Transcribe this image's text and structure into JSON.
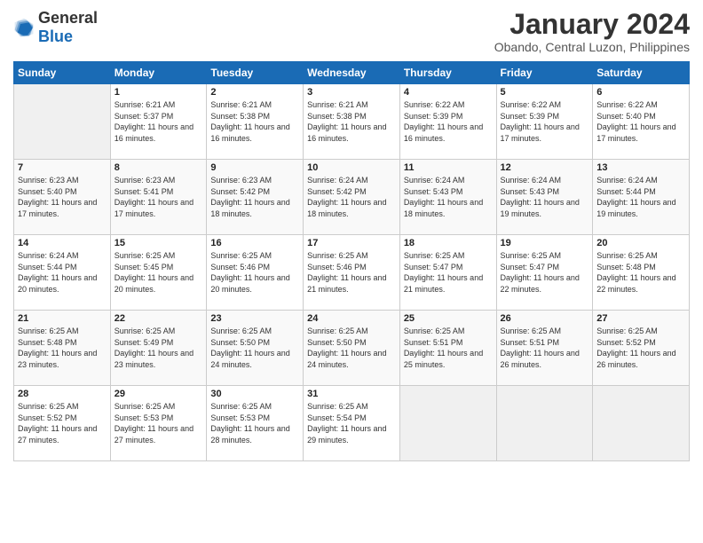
{
  "logo": {
    "text_general": "General",
    "text_blue": "Blue"
  },
  "title": "January 2024",
  "subtitle": "Obando, Central Luzon, Philippines",
  "days_of_week": [
    "Sunday",
    "Monday",
    "Tuesday",
    "Wednesday",
    "Thursday",
    "Friday",
    "Saturday"
  ],
  "weeks": [
    [
      {
        "num": "",
        "sunrise": "",
        "sunset": "",
        "daylight": "",
        "empty": true
      },
      {
        "num": "1",
        "sunrise": "Sunrise: 6:21 AM",
        "sunset": "Sunset: 5:37 PM",
        "daylight": "Daylight: 11 hours and 16 minutes."
      },
      {
        "num": "2",
        "sunrise": "Sunrise: 6:21 AM",
        "sunset": "Sunset: 5:38 PM",
        "daylight": "Daylight: 11 hours and 16 minutes."
      },
      {
        "num": "3",
        "sunrise": "Sunrise: 6:21 AM",
        "sunset": "Sunset: 5:38 PM",
        "daylight": "Daylight: 11 hours and 16 minutes."
      },
      {
        "num": "4",
        "sunrise": "Sunrise: 6:22 AM",
        "sunset": "Sunset: 5:39 PM",
        "daylight": "Daylight: 11 hours and 16 minutes."
      },
      {
        "num": "5",
        "sunrise": "Sunrise: 6:22 AM",
        "sunset": "Sunset: 5:39 PM",
        "daylight": "Daylight: 11 hours and 17 minutes."
      },
      {
        "num": "6",
        "sunrise": "Sunrise: 6:22 AM",
        "sunset": "Sunset: 5:40 PM",
        "daylight": "Daylight: 11 hours and 17 minutes."
      }
    ],
    [
      {
        "num": "7",
        "sunrise": "Sunrise: 6:23 AM",
        "sunset": "Sunset: 5:40 PM",
        "daylight": "Daylight: 11 hours and 17 minutes."
      },
      {
        "num": "8",
        "sunrise": "Sunrise: 6:23 AM",
        "sunset": "Sunset: 5:41 PM",
        "daylight": "Daylight: 11 hours and 17 minutes."
      },
      {
        "num": "9",
        "sunrise": "Sunrise: 6:23 AM",
        "sunset": "Sunset: 5:42 PM",
        "daylight": "Daylight: 11 hours and 18 minutes."
      },
      {
        "num": "10",
        "sunrise": "Sunrise: 6:24 AM",
        "sunset": "Sunset: 5:42 PM",
        "daylight": "Daylight: 11 hours and 18 minutes."
      },
      {
        "num": "11",
        "sunrise": "Sunrise: 6:24 AM",
        "sunset": "Sunset: 5:43 PM",
        "daylight": "Daylight: 11 hours and 18 minutes."
      },
      {
        "num": "12",
        "sunrise": "Sunrise: 6:24 AM",
        "sunset": "Sunset: 5:43 PM",
        "daylight": "Daylight: 11 hours and 19 minutes."
      },
      {
        "num": "13",
        "sunrise": "Sunrise: 6:24 AM",
        "sunset": "Sunset: 5:44 PM",
        "daylight": "Daylight: 11 hours and 19 minutes."
      }
    ],
    [
      {
        "num": "14",
        "sunrise": "Sunrise: 6:24 AM",
        "sunset": "Sunset: 5:44 PM",
        "daylight": "Daylight: 11 hours and 20 minutes."
      },
      {
        "num": "15",
        "sunrise": "Sunrise: 6:25 AM",
        "sunset": "Sunset: 5:45 PM",
        "daylight": "Daylight: 11 hours and 20 minutes."
      },
      {
        "num": "16",
        "sunrise": "Sunrise: 6:25 AM",
        "sunset": "Sunset: 5:46 PM",
        "daylight": "Daylight: 11 hours and 20 minutes."
      },
      {
        "num": "17",
        "sunrise": "Sunrise: 6:25 AM",
        "sunset": "Sunset: 5:46 PM",
        "daylight": "Daylight: 11 hours and 21 minutes."
      },
      {
        "num": "18",
        "sunrise": "Sunrise: 6:25 AM",
        "sunset": "Sunset: 5:47 PM",
        "daylight": "Daylight: 11 hours and 21 minutes."
      },
      {
        "num": "19",
        "sunrise": "Sunrise: 6:25 AM",
        "sunset": "Sunset: 5:47 PM",
        "daylight": "Daylight: 11 hours and 22 minutes."
      },
      {
        "num": "20",
        "sunrise": "Sunrise: 6:25 AM",
        "sunset": "Sunset: 5:48 PM",
        "daylight": "Daylight: 11 hours and 22 minutes."
      }
    ],
    [
      {
        "num": "21",
        "sunrise": "Sunrise: 6:25 AM",
        "sunset": "Sunset: 5:48 PM",
        "daylight": "Daylight: 11 hours and 23 minutes."
      },
      {
        "num": "22",
        "sunrise": "Sunrise: 6:25 AM",
        "sunset": "Sunset: 5:49 PM",
        "daylight": "Daylight: 11 hours and 23 minutes."
      },
      {
        "num": "23",
        "sunrise": "Sunrise: 6:25 AM",
        "sunset": "Sunset: 5:50 PM",
        "daylight": "Daylight: 11 hours and 24 minutes."
      },
      {
        "num": "24",
        "sunrise": "Sunrise: 6:25 AM",
        "sunset": "Sunset: 5:50 PM",
        "daylight": "Daylight: 11 hours and 24 minutes."
      },
      {
        "num": "25",
        "sunrise": "Sunrise: 6:25 AM",
        "sunset": "Sunset: 5:51 PM",
        "daylight": "Daylight: 11 hours and 25 minutes."
      },
      {
        "num": "26",
        "sunrise": "Sunrise: 6:25 AM",
        "sunset": "Sunset: 5:51 PM",
        "daylight": "Daylight: 11 hours and 26 minutes."
      },
      {
        "num": "27",
        "sunrise": "Sunrise: 6:25 AM",
        "sunset": "Sunset: 5:52 PM",
        "daylight": "Daylight: 11 hours and 26 minutes."
      }
    ],
    [
      {
        "num": "28",
        "sunrise": "Sunrise: 6:25 AM",
        "sunset": "Sunset: 5:52 PM",
        "daylight": "Daylight: 11 hours and 27 minutes."
      },
      {
        "num": "29",
        "sunrise": "Sunrise: 6:25 AM",
        "sunset": "Sunset: 5:53 PM",
        "daylight": "Daylight: 11 hours and 27 minutes."
      },
      {
        "num": "30",
        "sunrise": "Sunrise: 6:25 AM",
        "sunset": "Sunset: 5:53 PM",
        "daylight": "Daylight: 11 hours and 28 minutes."
      },
      {
        "num": "31",
        "sunrise": "Sunrise: 6:25 AM",
        "sunset": "Sunset: 5:54 PM",
        "daylight": "Daylight: 11 hours and 29 minutes."
      },
      {
        "num": "",
        "sunrise": "",
        "sunset": "",
        "daylight": "",
        "empty": true
      },
      {
        "num": "",
        "sunrise": "",
        "sunset": "",
        "daylight": "",
        "empty": true
      },
      {
        "num": "",
        "sunrise": "",
        "sunset": "",
        "daylight": "",
        "empty": true
      }
    ]
  ]
}
